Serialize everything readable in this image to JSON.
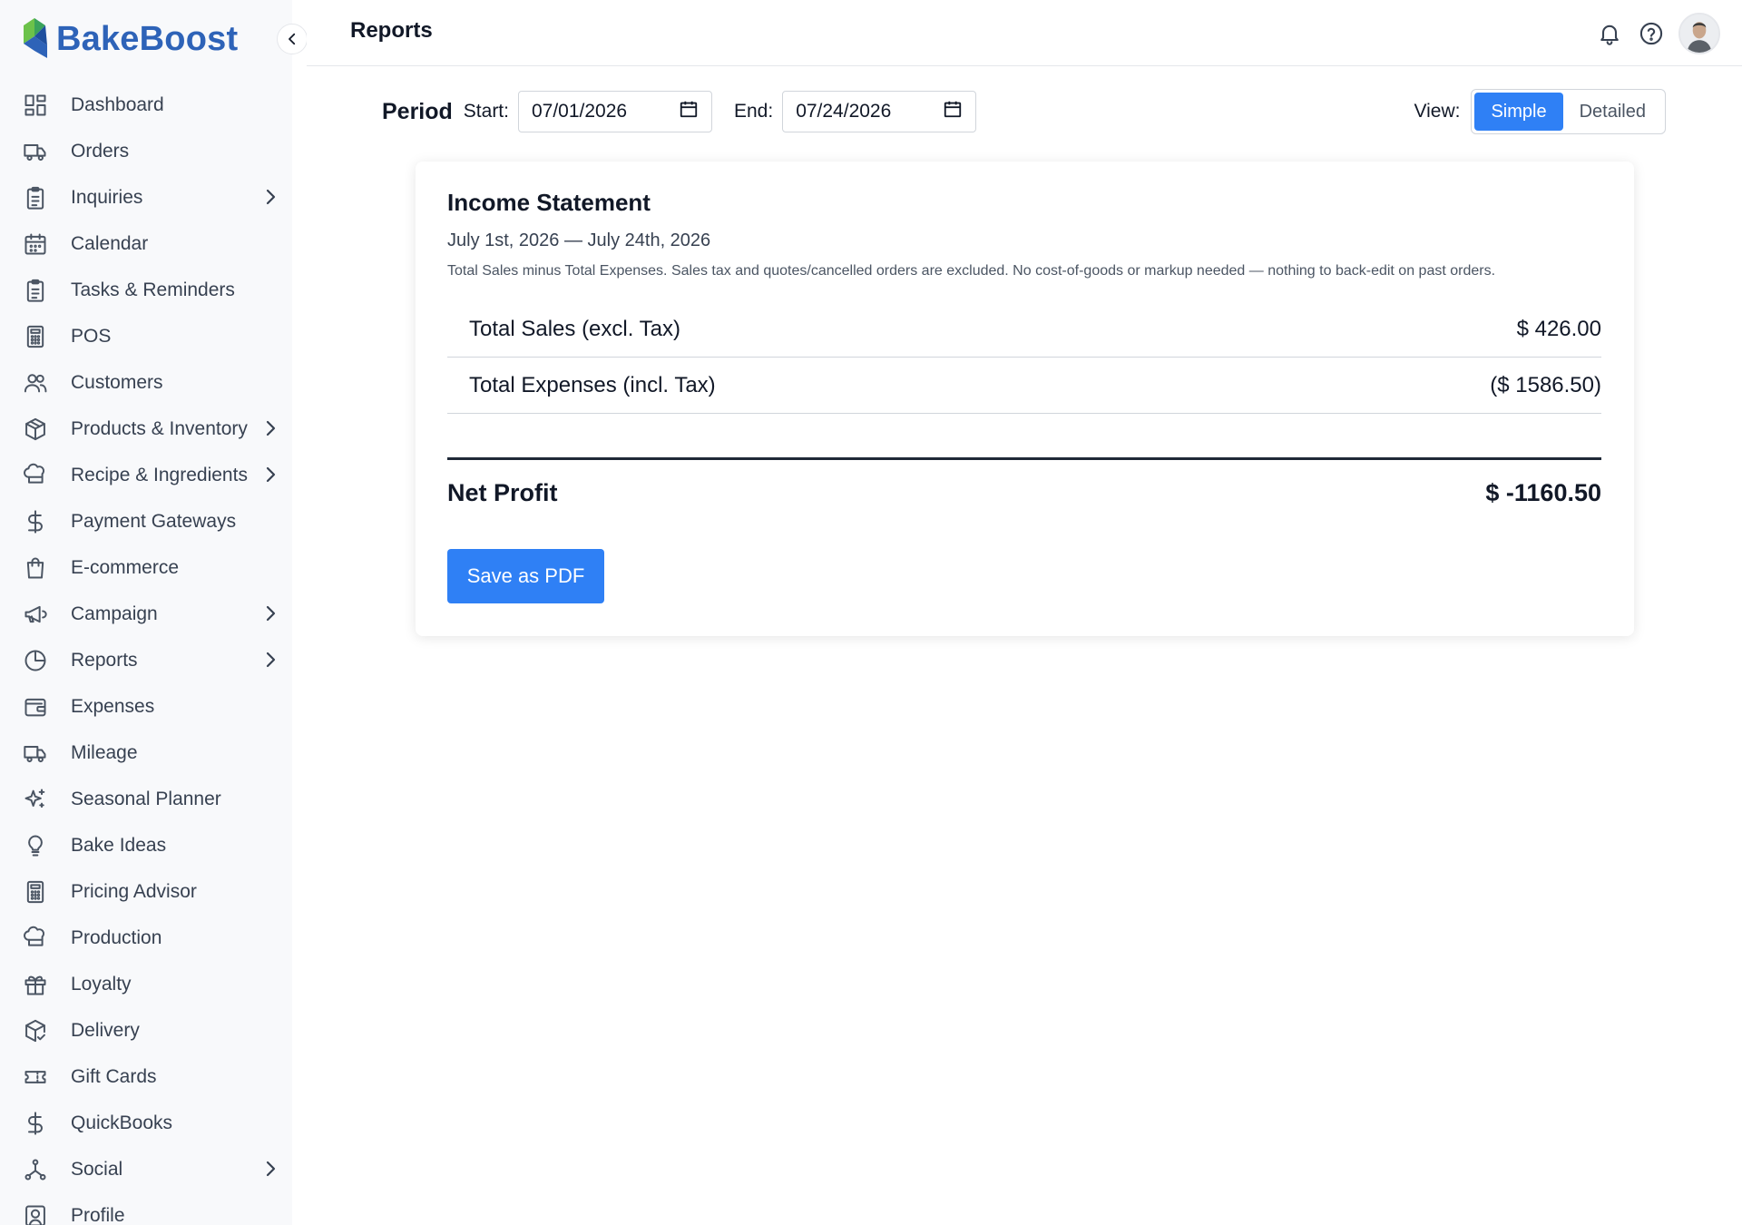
{
  "brand": {
    "name": "BakeBoost"
  },
  "sidebar": {
    "items": [
      {
        "label": "Dashboard",
        "icon": "dashboard-icon",
        "chevron": false
      },
      {
        "label": "Orders",
        "icon": "truck-icon",
        "chevron": false
      },
      {
        "label": "Inquiries",
        "icon": "clipboard-icon",
        "chevron": true
      },
      {
        "label": "Calendar",
        "icon": "calendar-icon",
        "chevron": false
      },
      {
        "label": "Tasks & Reminders",
        "icon": "clipboard-icon",
        "chevron": false
      },
      {
        "label": "POS",
        "icon": "calculator-icon",
        "chevron": false
      },
      {
        "label": "Customers",
        "icon": "users-icon",
        "chevron": false
      },
      {
        "label": "Products & Inventory",
        "icon": "box-icon",
        "chevron": true
      },
      {
        "label": "Recipe & Ingredients",
        "icon": "chef-hat-icon",
        "chevron": true
      },
      {
        "label": "Payment Gateways",
        "icon": "dollar-icon",
        "chevron": false
      },
      {
        "label": "E-commerce",
        "icon": "shopping-bag-icon",
        "chevron": false
      },
      {
        "label": "Campaign",
        "icon": "megaphone-icon",
        "chevron": true
      },
      {
        "label": "Reports",
        "icon": "pie-chart-icon",
        "chevron": true
      },
      {
        "label": "Expenses",
        "icon": "wallet-icon",
        "chevron": false
      },
      {
        "label": "Mileage",
        "icon": "truck-icon",
        "chevron": false
      },
      {
        "label": "Seasonal Planner",
        "icon": "sparkles-icon",
        "chevron": false
      },
      {
        "label": "Bake Ideas",
        "icon": "lightbulb-icon",
        "chevron": false
      },
      {
        "label": "Pricing Advisor",
        "icon": "calculator-icon",
        "chevron": false
      },
      {
        "label": "Production",
        "icon": "chef-hat-icon",
        "chevron": false
      },
      {
        "label": "Loyalty",
        "icon": "gift-icon",
        "chevron": false
      },
      {
        "label": "Delivery",
        "icon": "box-check-icon",
        "chevron": false
      },
      {
        "label": "Gift Cards",
        "icon": "ticket-icon",
        "chevron": false
      },
      {
        "label": "QuickBooks",
        "icon": "dollar-icon",
        "chevron": false
      },
      {
        "label": "Social",
        "icon": "network-icon",
        "chevron": true
      },
      {
        "label": "Profile",
        "icon": "profile-icon",
        "chevron": false
      }
    ]
  },
  "header": {
    "title": "Reports"
  },
  "period": {
    "title": "Period",
    "start_label": "Start:",
    "start_value": "07/01/2026",
    "end_label": "End:",
    "end_value": "07/24/2026"
  },
  "view": {
    "label": "View:",
    "options": [
      "Simple",
      "Detailed"
    ],
    "selected": "Simple"
  },
  "statement": {
    "title": "Income Statement",
    "range": "July 1st, 2026 — July 24th, 2026",
    "note": "Total Sales minus Total Expenses. Sales tax and quotes/cancelled orders are excluded. No cost-of-goods or markup needed — nothing to back-edit on past orders.",
    "rows": [
      {
        "label": "Total Sales (excl. Tax)",
        "value": "$ 426.00"
      },
      {
        "label": "Total Expenses (incl. Tax)",
        "value": "($ 1586.50)"
      }
    ],
    "net_label": "Net Profit",
    "net_value": "$ -1160.50",
    "pdf_button": "Save as PDF"
  },
  "colors": {
    "accent": "#2f80f5",
    "brand": "#2e63b8"
  }
}
